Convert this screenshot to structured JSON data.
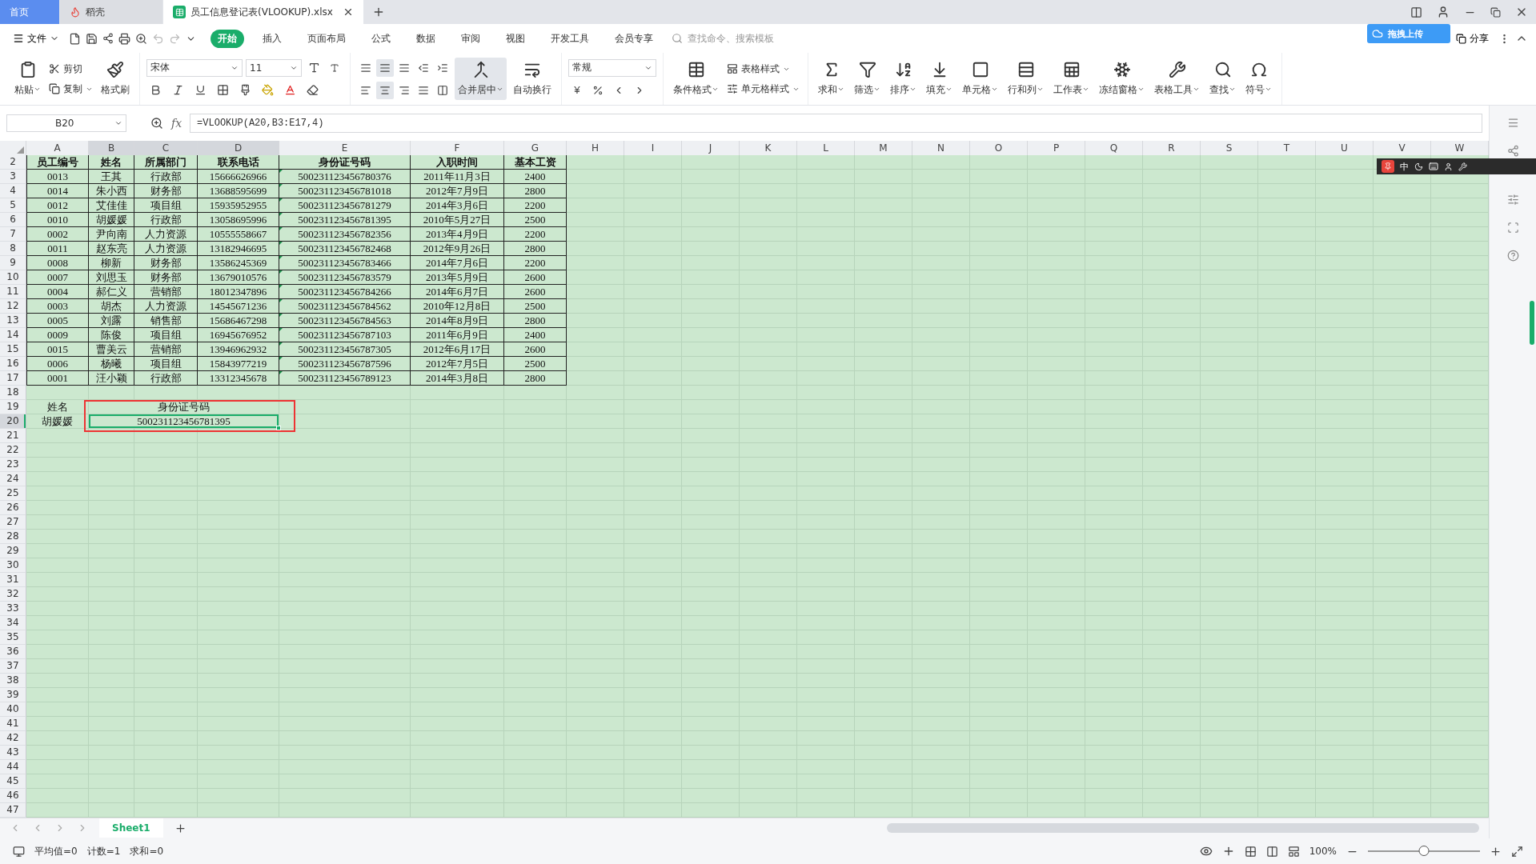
{
  "app_tabs": [
    {
      "label": "首页",
      "kind": "home",
      "selected": false
    },
    {
      "label": "稻壳",
      "kind": "docer",
      "selected": false
    },
    {
      "label": "员工信息登记表(VLOOKUP).xlsx",
      "kind": "sheet",
      "selected": true
    }
  ],
  "upload_widget": {
    "label": "拖拽上传"
  },
  "menu": {
    "file": "文件",
    "items": [
      {
        "label": "开始",
        "selected": true
      },
      {
        "label": "插入",
        "selected": false
      },
      {
        "label": "页面布局",
        "selected": false
      },
      {
        "label": "公式",
        "selected": false
      },
      {
        "label": "数据",
        "selected": false
      },
      {
        "label": "审阅",
        "selected": false
      },
      {
        "label": "视图",
        "selected": false
      },
      {
        "label": "开发工具",
        "selected": false
      },
      {
        "label": "会员专享",
        "selected": false
      }
    ],
    "search": {
      "placeholder": "查找命令、搜索模板"
    },
    "share": "分享"
  },
  "ribbon": {
    "paste": "粘贴",
    "cut": "剪切",
    "copy": "复制",
    "format_painter": "格式刷",
    "font": "宋体",
    "font_size": "11",
    "valign": [
      {
        "selected": false
      },
      {
        "selected": true
      },
      {
        "selected": false
      }
    ],
    "halign": [
      {
        "selected": false
      },
      {
        "selected": true
      },
      {
        "selected": false
      }
    ],
    "merge": {
      "label": "合并居中",
      "selected": true
    },
    "wrap": "自动换行",
    "number_format": "常规",
    "currency": "¥",
    "conditional_format": "条件格式",
    "table_style": "表格样式",
    "cell_style": "单元格样式",
    "tools": [
      {
        "label": "求和"
      },
      {
        "label": "筛选"
      },
      {
        "label": "排序"
      },
      {
        "label": "填充"
      },
      {
        "label": "单元格"
      },
      {
        "label": "行和列"
      },
      {
        "label": "工作表"
      },
      {
        "label": "冻结窗格"
      },
      {
        "label": "表格工具"
      },
      {
        "label": "查找"
      },
      {
        "label": "符号"
      }
    ]
  },
  "name_box": "B20",
  "function_label": "fx",
  "formula": "=VLOOKUP(A20,B3:E17,4)",
  "columns": [
    {
      "label": "A",
      "selected": false
    },
    {
      "label": "B",
      "selected": true
    },
    {
      "label": "C",
      "selected": true
    },
    {
      "label": "D",
      "selected": true
    },
    {
      "label": "E",
      "selected": false
    },
    {
      "label": "F",
      "selected": false
    },
    {
      "label": "G",
      "selected": false
    },
    {
      "label": "H",
      "selected": false
    },
    {
      "label": "I",
      "selected": false
    },
    {
      "label": "J",
      "selected": false
    },
    {
      "label": "K",
      "selected": false
    },
    {
      "label": "L",
      "selected": false
    },
    {
      "label": "M",
      "selected": false
    },
    {
      "label": "N",
      "selected": false
    },
    {
      "label": "O",
      "selected": false
    },
    {
      "label": "P",
      "selected": false
    },
    {
      "label": "Q",
      "selected": false
    },
    {
      "label": "R",
      "selected": false
    },
    {
      "label": "S",
      "selected": false
    },
    {
      "label": "T",
      "selected": false
    },
    {
      "label": "U",
      "selected": false
    },
    {
      "label": "V",
      "selected": false
    },
    {
      "label": "W",
      "selected": false
    }
  ],
  "row_numbers": [
    {
      "label": "2",
      "selected": false
    },
    {
      "label": "3",
      "selected": false
    },
    {
      "label": "4",
      "selected": false
    },
    {
      "label": "5",
      "selected": false
    },
    {
      "label": "6",
      "selected": false
    },
    {
      "label": "7",
      "selected": false
    },
    {
      "label": "8",
      "selected": false
    },
    {
      "label": "9",
      "selected": false
    },
    {
      "label": "10",
      "selected": false
    },
    {
      "label": "11",
      "selected": false
    },
    {
      "label": "12",
      "selected": false
    },
    {
      "label": "13",
      "selected": false
    },
    {
      "label": "14",
      "selected": false
    },
    {
      "label": "15",
      "selected": false
    },
    {
      "label": "16",
      "selected": false
    },
    {
      "label": "17",
      "selected": false
    },
    {
      "label": "18",
      "selected": false
    },
    {
      "label": "19",
      "selected": false
    },
    {
      "label": "20",
      "selected": true
    },
    {
      "label": "21",
      "selected": false
    },
    {
      "label": "22",
      "selected": false
    },
    {
      "label": "23",
      "selected": false
    },
    {
      "label": "24",
      "selected": false
    },
    {
      "label": "25",
      "selected": false
    },
    {
      "label": "26",
      "selected": false
    },
    {
      "label": "27",
      "selected": false
    },
    {
      "label": "28",
      "selected": false
    },
    {
      "label": "29",
      "selected": false
    },
    {
      "label": "30",
      "selected": false
    },
    {
      "label": "31",
      "selected": false
    },
    {
      "label": "32",
      "selected": false
    },
    {
      "label": "33",
      "selected": false
    },
    {
      "label": "34",
      "selected": false
    },
    {
      "label": "35",
      "selected": false
    },
    {
      "label": "36",
      "selected": false
    },
    {
      "label": "37",
      "selected": false
    },
    {
      "label": "38",
      "selected": false
    },
    {
      "label": "39",
      "selected": false
    },
    {
      "label": "40",
      "selected": false
    },
    {
      "label": "41",
      "selected": false
    },
    {
      "label": "42",
      "selected": false
    },
    {
      "label": "43",
      "selected": false
    },
    {
      "label": "44",
      "selected": false
    },
    {
      "label": "45",
      "selected": false
    },
    {
      "label": "46",
      "selected": false
    },
    {
      "label": "47",
      "selected": false
    }
  ],
  "table": {
    "header": [
      "员工编号",
      "姓名",
      "所属部门",
      "联系电话",
      "身份证号码",
      "入职时间",
      "基本工资"
    ],
    "rows": [
      [
        "0013",
        "王其",
        "行政部",
        "15666626966",
        "500231123456780376",
        "2011年11月3日",
        "2400"
      ],
      [
        "0014",
        "朱小西",
        "财务部",
        "13688595699",
        "500231123456781018",
        "2012年7月9日",
        "2800"
      ],
      [
        "0012",
        "艾佳佳",
        "项目组",
        "15935952955",
        "500231123456781279",
        "2014年3月6日",
        "2200"
      ],
      [
        "0010",
        "胡媛媛",
        "行政部",
        "13058695996",
        "500231123456781395",
        "2010年5月27日",
        "2500"
      ],
      [
        "0002",
        "尹向南",
        "人力资源",
        "10555558667",
        "500231123456782356",
        "2013年4月9日",
        "2200"
      ],
      [
        "0011",
        "赵东亮",
        "人力资源",
        "13182946695",
        "500231123456782468",
        "2012年9月26日",
        "2800"
      ],
      [
        "0008",
        "柳新",
        "财务部",
        "13586245369",
        "500231123456783466",
        "2014年7月6日",
        "2200"
      ],
      [
        "0007",
        "刘思玉",
        "财务部",
        "13679010576",
        "500231123456783579",
        "2013年5月9日",
        "2600"
      ],
      [
        "0004",
        "郝仁义",
        "营销部",
        "18012347896",
        "500231123456784266",
        "2014年6月7日",
        "2600"
      ],
      [
        "0003",
        "胡杰",
        "人力资源",
        "14545671236",
        "500231123456784562",
        "2010年12月8日",
        "2500"
      ],
      [
        "0005",
        "刘露",
        "销售部",
        "15686467298",
        "500231123456784563",
        "2014年8月9日",
        "2800"
      ],
      [
        "0009",
        "陈俊",
        "项目组",
        "16945676952",
        "500231123456787103",
        "2011年6月9日",
        "2400"
      ],
      [
        "0015",
        "曹美云",
        "营销部",
        "13946962932",
        "500231123456787305",
        "2012年6月17日",
        "2600"
      ],
      [
        "0006",
        "杨曦",
        "项目组",
        "15843977219",
        "500231123456787596",
        "2012年7月5日",
        "2500"
      ],
      [
        "0001",
        "汪小颖",
        "行政部",
        "13312345678",
        "500231123456789123",
        "2014年3月8日",
        "2800"
      ]
    ]
  },
  "lookup": {
    "name_label": "姓名",
    "id_label": "身份证号码",
    "name": "胡媛媛",
    "id": "500231123456781395",
    "id_selected": true
  },
  "ime_bar": {
    "mode": "中"
  },
  "sheet_tabs": [
    {
      "label": "Sheet1",
      "selected": true
    }
  ],
  "status_bar": {
    "stats": [
      "平均值=0",
      "计数=1",
      "求和=0"
    ],
    "zoom": "100%",
    "zoom_slider": {
      "level": 0.5
    }
  }
}
